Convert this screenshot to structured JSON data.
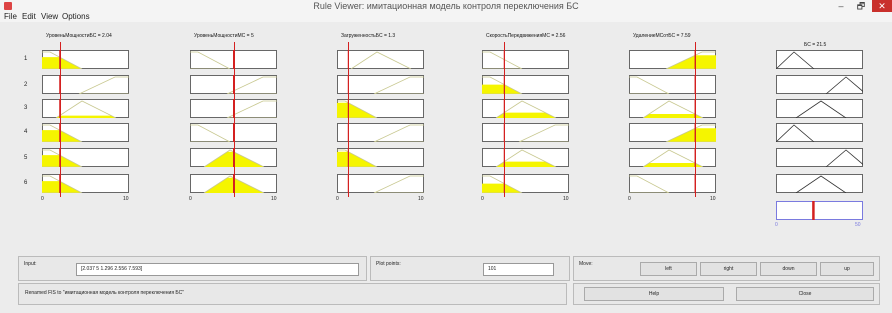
{
  "window": {
    "title": "Rule Viewer: имитационная модель контроля переключения БС",
    "minimize": "–",
    "maximize": "🗗",
    "close": "✕"
  },
  "menu": [
    "File",
    "Edit",
    "View",
    "Options"
  ],
  "inputs": [
    {
      "header": "УровеньМощностиБС = 2.04",
      "mfs": [
        "trapl",
        "trapr",
        "tri",
        "trapl",
        "trapl",
        "trapl"
      ],
      "value": 2.037,
      "cutRows": [
        0,
        2,
        3,
        4,
        5
      ],
      "ticks": [
        "0",
        "10"
      ]
    },
    {
      "header": "УровеньМощностиМС = 5",
      "mfs": [
        "trapl",
        "trapr",
        "trapr",
        "trapl",
        "tri",
        "tri"
      ],
      "value": 5,
      "cutRows": [
        4,
        5
      ],
      "ticks": [
        "0",
        "10"
      ]
    },
    {
      "header": "ЗагруженностьБС = 1.3",
      "mfs": [
        "tri",
        "trapr",
        "trapl",
        "trapr",
        "trapl",
        "trapr"
      ],
      "value": 1.296,
      "cutRows": [
        2,
        4
      ],
      "ticks": [
        "0",
        "10"
      ]
    },
    {
      "header": "СкоростьПередвиженияМС = 2.56",
      "mfs": [
        "trapl",
        "trapl",
        "tri",
        "trapr",
        "tri",
        "trapl"
      ],
      "value": 2.556,
      "cutRows": [
        1,
        2,
        4,
        5
      ],
      "ticks": [
        "0",
        "10"
      ]
    },
    {
      "header": "УдалениеМСотБС = 7.59",
      "mfs": [
        "trapr",
        "trapl",
        "tri",
        "trapr",
        "tri",
        "trapl"
      ],
      "value": 7.593,
      "cutRows": [
        0,
        2,
        3,
        4
      ],
      "ticks": [
        "0",
        "10"
      ]
    }
  ],
  "output": {
    "header": "БС = 21.5",
    "mfs": [
      "tri_l",
      "tri_r",
      "tri_m",
      "tri_l",
      "tri_r",
      "tri_m"
    ],
    "value": 21.5,
    "ticks": [
      "0",
      "50"
    ]
  },
  "rows": [
    "1",
    "2",
    "3",
    "4",
    "5",
    "6"
  ],
  "colors": {
    "fill": "#f5f500",
    "mfline": "#c8c890",
    "redline": "#d42020",
    "aggblue": "#7a7adf"
  },
  "bottom": {
    "input_label": "Input:",
    "input_value": "[2.037 5 1.296 2.556 7.593]",
    "plot_label": "Plot points:",
    "plot_value": "101",
    "move_label": "Move:",
    "move_buttons": [
      "left",
      "right",
      "down",
      "up"
    ],
    "status": "Renamed FIS to \"имитационная модель контроля переключения БС\"",
    "help": "Help",
    "close": "Close"
  }
}
